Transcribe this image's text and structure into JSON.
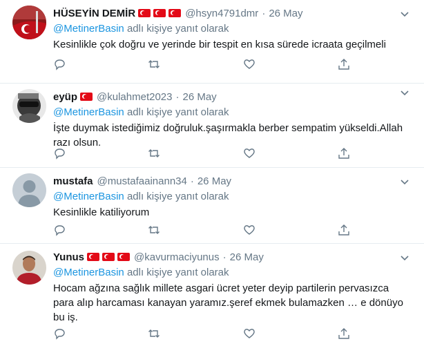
{
  "tweets": [
    {
      "name": "HÜSEYİN DEMİR",
      "flags": 3,
      "handle": "@hsyn4791dmr",
      "date": "26 May",
      "mention": "@MetinerBasin",
      "reply_suffix": "adlı kişiye yanıt olarak",
      "text": "Kesinlikle çok doğru ve yerinde bir tespit en kısa sürede icraata geçilmeli",
      "avatar": "flag-photo"
    },
    {
      "name": "eyüp",
      "flags": 1,
      "handle": "@kulahmet2023",
      "date": "26 May",
      "mention": "@MetinerBasin",
      "reply_suffix": "adlı kişiye yanıt olarak",
      "text": "İşte duymak istediğimiz doğruluk.şaşırmakla berber sempatim yükseldi.Allah razı olsun.",
      "avatar": "sunglasses-photo"
    },
    {
      "name": "mustafa",
      "flags": 0,
      "handle": "@mustafaainann34",
      "date": "26 May",
      "mention": "@MetinerBasin",
      "reply_suffix": "adlı kişiye yanıt olarak",
      "text": "Kesinlikle katiliyorum",
      "avatar": "default-avatar"
    },
    {
      "name": "Yunus",
      "flags": 3,
      "handle": "@kavurmaciyunus",
      "date": "26 May",
      "mention": "@MetinerBasin",
      "reply_suffix": "adlı kişiye yanıt olarak",
      "text": "Hocam ağzına sağlık millete asgari ücret yeter deyip partilerin pervasızca para alıp harcaması kanayan yaramız.şeref ekmek bulamazken … e dönüyo bu iş.",
      "avatar": "man-photo"
    }
  ],
  "dot": "·",
  "icons": [
    "reply-icon",
    "retweet-icon",
    "like-icon",
    "share-icon",
    "chevron-down-icon"
  ],
  "colors": {
    "link": "#1b95e0",
    "muted": "#657786",
    "text": "#14171a",
    "flag": "#e30a17"
  }
}
